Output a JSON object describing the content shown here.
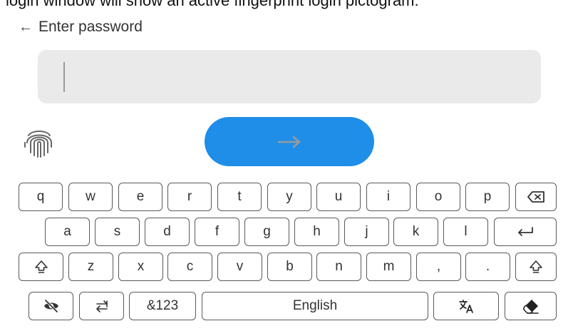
{
  "caption": "login window will show an active fingerprint login pictogram:",
  "header": {
    "back_icon": "arrow-left",
    "title": "Enter password"
  },
  "password": {
    "value": "",
    "icon": "fingerprint"
  },
  "submit": {
    "icon": "arrow-right"
  },
  "colors": {
    "accent": "#1e8ee8",
    "field_bg": "#eaeaea",
    "key_border": "#5a5a5a"
  },
  "keyboard": {
    "row1": [
      "q",
      "w",
      "e",
      "r",
      "t",
      "y",
      "u",
      "i",
      "o",
      "p"
    ],
    "row2": [
      "a",
      "s",
      "d",
      "f",
      "g",
      "h",
      "j",
      "k",
      "l"
    ],
    "row3": [
      "z",
      "x",
      "c",
      "v",
      "b",
      "n",
      "m",
      ",",
      "."
    ],
    "row4": {
      "numeric": "&123",
      "language": "English"
    },
    "icons": {
      "backspace": "backspace",
      "enter": "enter",
      "shift": "shift",
      "toggle_visibility": "eye-off",
      "swap": "swap-arrows",
      "translate": "translate",
      "clear": "eraser"
    }
  }
}
